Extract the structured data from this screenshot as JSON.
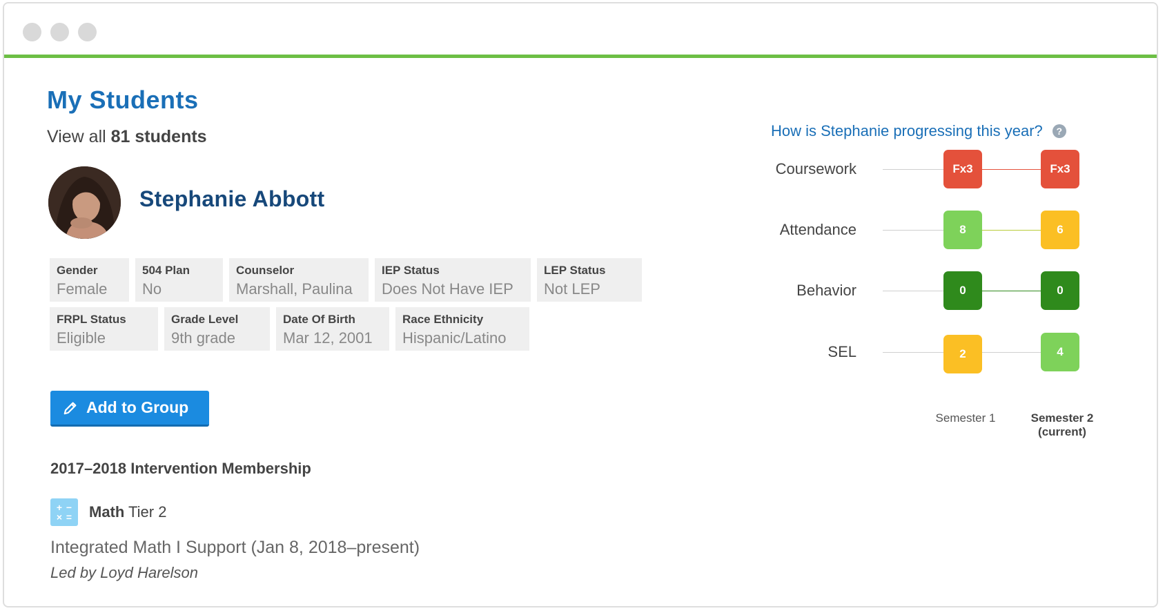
{
  "page": {
    "title": "My Students",
    "view_all_prefix": "View all ",
    "view_all_count": "81 students"
  },
  "student": {
    "name": "Stephanie Abbott",
    "attributes_row1": [
      {
        "label": "Gender",
        "value": "Female"
      },
      {
        "label": "504 Plan",
        "value": "No"
      },
      {
        "label": "Counselor",
        "value": "Marshall, Paulina"
      },
      {
        "label": "IEP Status",
        "value": "Does Not Have IEP"
      },
      {
        "label": "LEP Status",
        "value": "Not LEP"
      }
    ],
    "attributes_row2": [
      {
        "label": "FRPL Status",
        "value": "Eligible"
      },
      {
        "label": "Grade Level",
        "value": "9th grade"
      },
      {
        "label": "Date Of Birth",
        "value": "Mar 12, 2001"
      },
      {
        "label": "Race Ethnicity",
        "value": "Hispanic/Latino"
      }
    ]
  },
  "actions": {
    "add_to_group": "Add to Group"
  },
  "intervention": {
    "title": "2017–2018 Intervention Membership",
    "subject": "Math",
    "tier": " Tier 2",
    "course": "Integrated Math I Support (Jan 8, 2018–present)",
    "led_by": "Led by Loyd Harelson"
  },
  "progress": {
    "question": "How is Stephanie progressing this year?",
    "help_icon": "question-circle-icon",
    "metrics": [
      {
        "label": "Coursework",
        "sem1": "Fx3",
        "sem2": "Fx3",
        "sem1_color": "#e4513b",
        "sem2_color": "#e4513b",
        "line_color": "#e4513b"
      },
      {
        "label": "Attendance",
        "sem1": "8",
        "sem2": "6",
        "sem1_color": "#7ed25a",
        "sem2_color": "#fbbf24",
        "line_color": "#b9cc3a"
      },
      {
        "label": "Behavior",
        "sem1": "0",
        "sem2": "0",
        "sem1_color": "#2f8a1c",
        "sem2_color": "#2f8a1c",
        "line_color": "#2f8a1c"
      },
      {
        "label": "SEL",
        "sem1": "2",
        "sem2": "4",
        "sem1_color": "#fbbf24",
        "sem2_color": "#7ed25a",
        "line_color": "#cfcfcf"
      }
    ],
    "semester1_label": "Semester 1",
    "semester2_label": "Semester 2",
    "semester2_sub": "(current)"
  }
}
